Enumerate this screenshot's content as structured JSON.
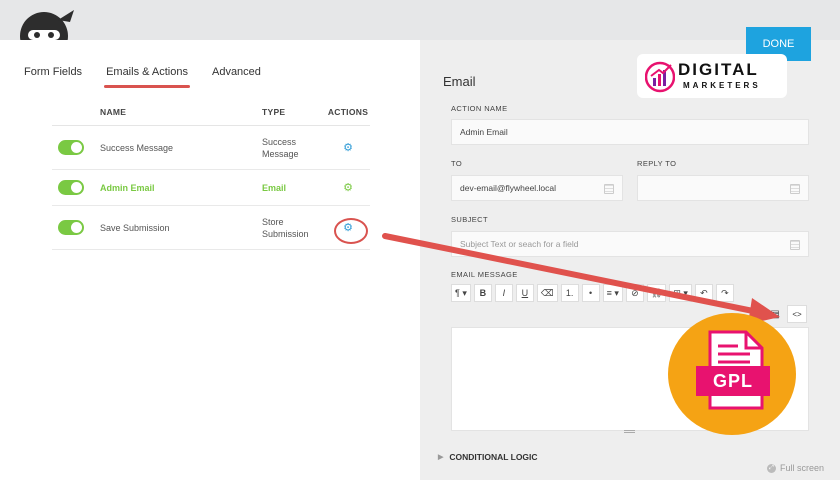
{
  "tabs": [
    {
      "label": "Form Fields",
      "active": false
    },
    {
      "label": "Emails & Actions",
      "active": true
    },
    {
      "label": "Advanced",
      "active": false
    }
  ],
  "table": {
    "headers": {
      "name": "NAME",
      "type": "TYPE",
      "actions": "ACTIONS"
    },
    "rows": [
      {
        "name": "Success Message",
        "type": "Success Message",
        "enabled": true,
        "active": false
      },
      {
        "name": "Admin Email",
        "type": "Email",
        "enabled": true,
        "active": true
      },
      {
        "name": "Save Submission",
        "type": "Store Submission",
        "enabled": true,
        "active": false
      }
    ]
  },
  "panel": {
    "done_label": "DONE",
    "title": "Email",
    "action_name_label": "ACTION NAME",
    "action_name_value": "Admin Email",
    "to_label": "TO",
    "to_value": "dev-email@flywheel.local",
    "reply_to_label": "REPLY TO",
    "reply_to_value": "",
    "subject_label": "SUBJECT",
    "subject_placeholder": "Subject Text or seach for a field",
    "message_label": "EMAIL MESSAGE",
    "toolbar": [
      "¶ ▾",
      "B",
      "I",
      "U",
      "⌫",
      "1.",
      "•",
      "≡ ▾",
      "⊘",
      "⛓",
      "⊞ ▾",
      "↶",
      "↷"
    ],
    "source_label": "<>",
    "conditional_logic_label": "CONDITIONAL LOGIC",
    "fullscreen_label": "Full screen"
  },
  "watermarks": {
    "brand_title": "DIGITAL",
    "brand_subtitle": "MARKETERS",
    "gpl_label": "GPL"
  },
  "colors": {
    "accent_green": "#7ac943",
    "accent_blue": "#1ea3df",
    "highlight_red": "#d9534f",
    "gpl_orange": "#f5a314",
    "gpl_pink": "#e8126f"
  }
}
